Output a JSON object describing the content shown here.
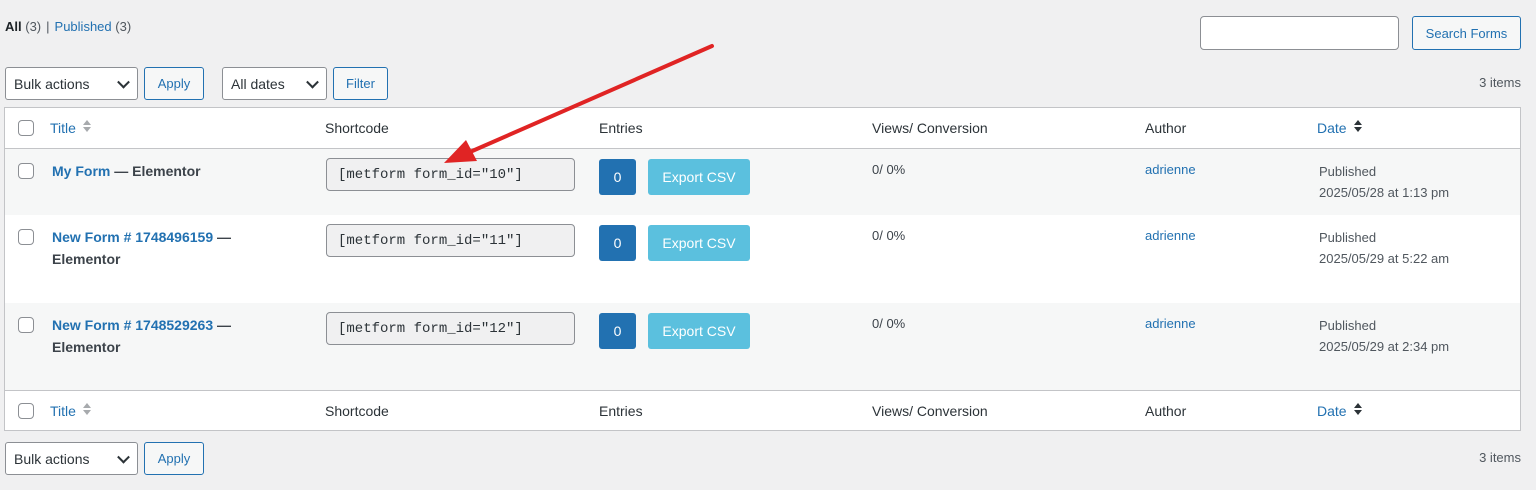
{
  "filters": {
    "all_label": "All",
    "all_count": "(3)",
    "separator": "|",
    "published_label": "Published",
    "published_count": "(3)"
  },
  "search": {
    "placeholder": "",
    "button_label": "Search Forms"
  },
  "top_nav": {
    "bulk_actions": "Bulk actions",
    "apply": "Apply",
    "dates": "All dates",
    "filter": "Filter",
    "items": "3 items"
  },
  "columns": {
    "title": "Title",
    "shortcode": "Shortcode",
    "entries": "Entries",
    "views": "Views/ Conversion",
    "author": "Author",
    "date": "Date"
  },
  "rows": [
    {
      "title": "My Form",
      "dash": "—",
      "state": "Elementor",
      "shortcode": "[metform form_id=\"10\"]",
      "entries": "0",
      "export": "Export CSV",
      "views": "0/ 0%",
      "author": "adrienne",
      "status": "Published",
      "date": "2025/05/28 at 1:13 pm"
    },
    {
      "title": "New Form # 1748496159",
      "dash": "—",
      "state": "Elementor",
      "shortcode": "[metform form_id=\"11\"]",
      "entries": "0",
      "export": "Export CSV",
      "views": "0/ 0%",
      "author": "adrienne",
      "status": "Published",
      "date": "2025/05/29 at 5:22 am"
    },
    {
      "title": "New Form # 1748529263",
      "dash": "—",
      "state": "Elementor",
      "shortcode": "[metform form_id=\"12\"]",
      "entries": "0",
      "export": "Export CSV",
      "views": "0/ 0%",
      "author": "adrienne",
      "status": "Published",
      "date": "2025/05/29 at 2:34 pm"
    }
  ],
  "bottom_nav": {
    "bulk_actions": "Bulk actions",
    "apply": "Apply",
    "items": "3 items"
  },
  "colors": {
    "link": "#2271b1",
    "entries_button": "#2271b1",
    "export_button": "#5bc0de",
    "annotation_arrow": "#e02424"
  }
}
